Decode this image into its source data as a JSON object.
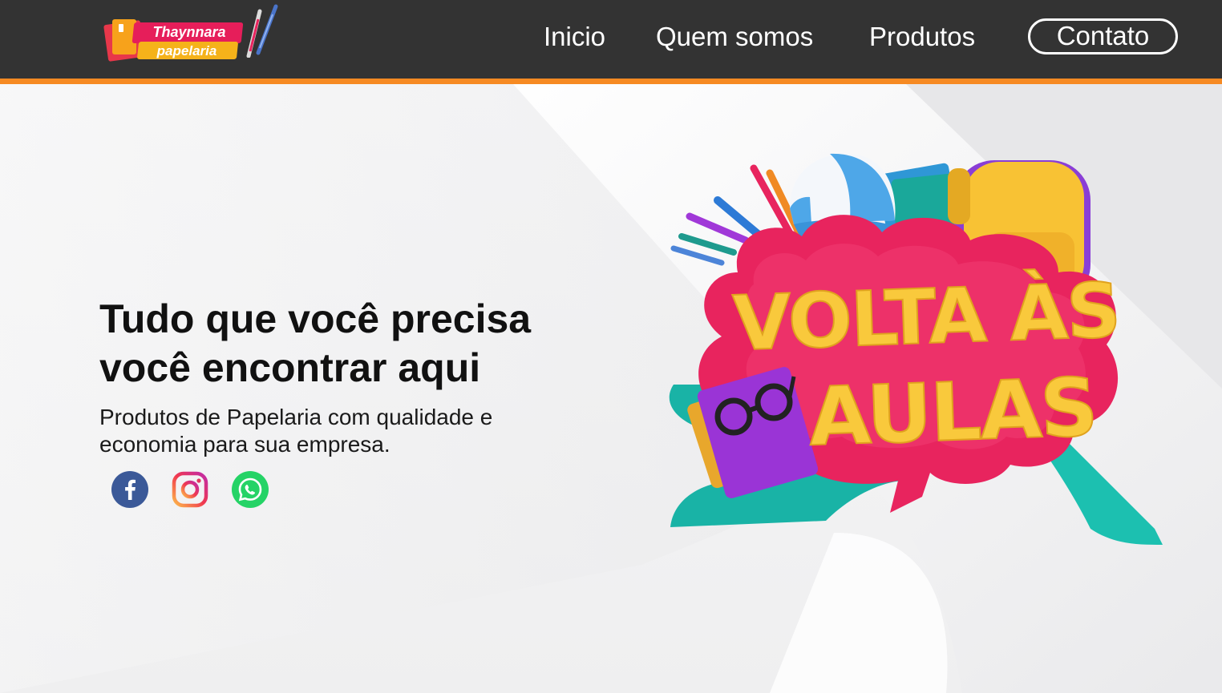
{
  "header": {
    "logo": {
      "line1": "Thaynnara",
      "line2": "papelaria"
    },
    "nav": {
      "inicio": "Inicio",
      "quem_somos": "Quem somos",
      "produtos": "Produtos",
      "contato": "Contato"
    }
  },
  "hero": {
    "title_line1": "Tudo que você precisa",
    "title_line2": "você encontrar aqui",
    "subtitle_line1": "Produtos de Papelaria com qualidade e",
    "subtitle_line2": "economia para sua empresa.",
    "social": [
      "facebook-icon",
      "instagram-icon",
      "whatsapp-icon"
    ],
    "promo_banner": {
      "line1": "VOLTA ÀS",
      "line2": "AULAS"
    }
  },
  "colors": {
    "header_bg": "#333333",
    "accent_stripe": "#f68a23",
    "facebook": "#3b5998",
    "whatsapp": "#25d366",
    "banner_pink": "#e8245e",
    "banner_text": "#f9c93c"
  }
}
